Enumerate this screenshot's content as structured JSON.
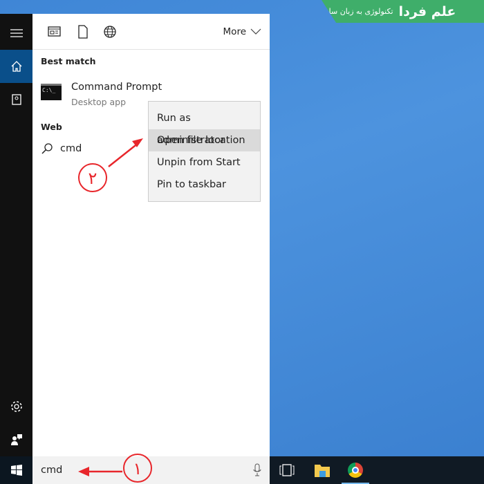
{
  "logo": {
    "brand": "علم فردا",
    "tagline": "تکنولوژی به زبان ساده"
  },
  "toolbar": {
    "icons": [
      "apps-icon",
      "documents-icon",
      "web-icon"
    ],
    "more_label": "More"
  },
  "sections": {
    "best_match": "Best match",
    "web": "Web"
  },
  "best_match": {
    "title": "Command Prompt",
    "subtitle": "Desktop app",
    "icon_text": "C:\\_"
  },
  "web_result": {
    "text": "cmd"
  },
  "context_menu": {
    "items": [
      "Run as administrator",
      "Open file location",
      "Unpin from Start",
      "Pin to taskbar"
    ],
    "highlighted": "Open file location"
  },
  "search": {
    "value": "cmd"
  },
  "annotations": {
    "step1": "١",
    "step2": "٢",
    "color": "#e8262b"
  },
  "colors": {
    "accent": "#0a4f8a",
    "sidebar": "#111111"
  }
}
